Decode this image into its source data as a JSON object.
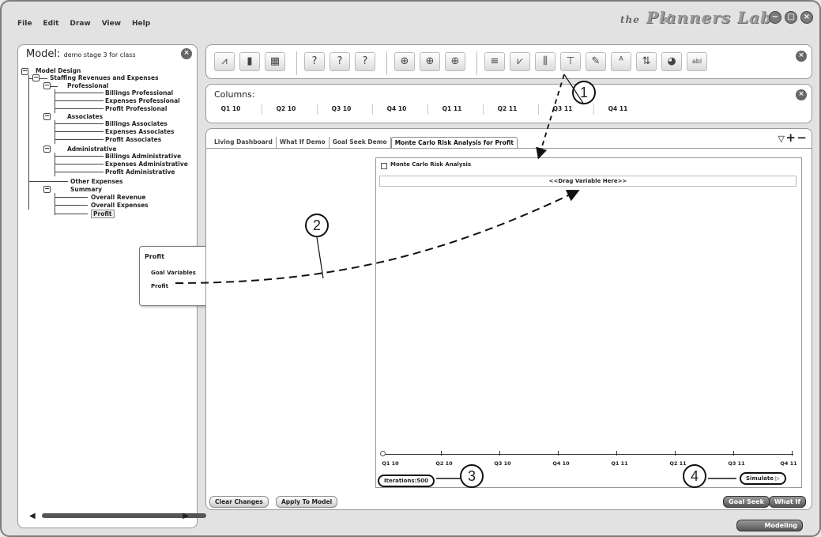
{
  "menu": [
    "File",
    "Edit",
    "Draw",
    "View",
    "Help"
  ],
  "brand": {
    "prefix": "the",
    "name": "Planners Lab"
  },
  "window_buttons": [
    "minimize-icon",
    "maximize-icon",
    "close-icon"
  ],
  "model": {
    "title": "Model:",
    "name": "demo stage 3 for class",
    "tree": [
      "Model Design",
      "Staffing Revenues and Expenses",
      "Professional",
      "Billings Professional",
      "Expenses Professional",
      "Profit Professional",
      "Associates",
      "Billings Associates",
      "Expenses Associates",
      "Profit Associates",
      "Administrative",
      "Billings Administrative",
      "Expenses Administrative",
      "Profit  Administrative",
      "Other Expenses",
      "Summary",
      "Overall Revenue",
      "Overall Expenses",
      "Profit"
    ]
  },
  "popup": {
    "title": "Profit",
    "section": "Goal Variables",
    "item": "Profit"
  },
  "columns": {
    "label": "Columns:",
    "items": [
      "Q1 10",
      "Q2 10",
      "Q3 10",
      "Q4 10",
      "Q1 11",
      "Q2 11",
      "Q3 11",
      "Q4 11"
    ]
  },
  "tabs": [
    "Living Dashboard",
    "What If Demo",
    "Goal Seek Demo",
    "Monte Carlo Risk Analysis for Profit"
  ],
  "monte_carlo": {
    "title": "Monte Carlo Risk Analysis",
    "drag_hint": "<<Drag Variable Here>>",
    "axis_labels": [
      "Q1 10",
      "Q2 10",
      "Q3 10",
      "Q4 10",
      "Q1 11",
      "Q2 11",
      "Q3 11",
      "Q4 11"
    ],
    "iterations": "Iterations:500",
    "simulate": "Simulate"
  },
  "buttons": {
    "clear": "Clear Changes",
    "apply": "Apply To Model",
    "goal_seek": "Goal Seek",
    "what_if": "What If",
    "modeling": "Modeling"
  },
  "callouts": [
    "1",
    "2",
    "3",
    "4"
  ],
  "tab_controls": {
    "dropdown": "▽",
    "add": "+",
    "remove": "−"
  }
}
